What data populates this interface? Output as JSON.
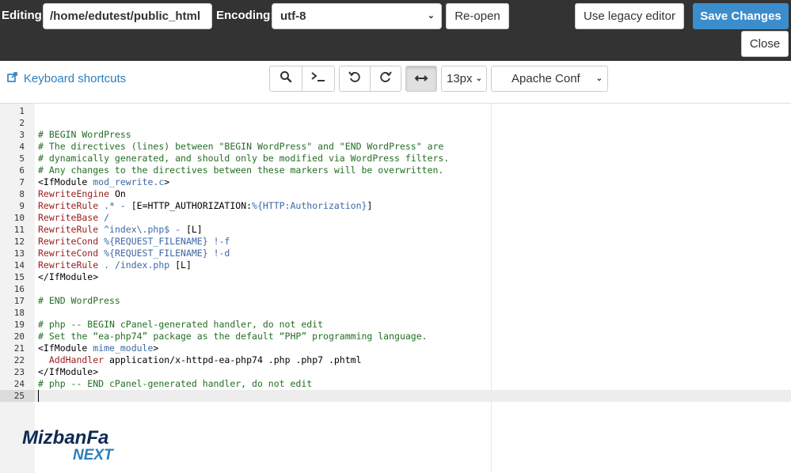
{
  "header": {
    "editing_label": "Editing:",
    "file_path": "/home/edutest/public_html",
    "encoding_label": "Encoding:",
    "encoding_value": "utf-8",
    "reopen_label": "Re-open",
    "legacy_label": "Use legacy editor",
    "save_label": "Save Changes",
    "close_label": "Close"
  },
  "toolbar": {
    "keyboard_shortcuts": "Keyboard shortcuts",
    "font_size": "13px",
    "mode": "Apache Conf"
  },
  "icons": [
    "external-link-icon",
    "search-icon",
    "terminal-icon",
    "undo-icon",
    "redo-icon",
    "wrap-icon",
    "chevron-down-icon"
  ],
  "colors": {
    "topbar": "#333333",
    "primary": "#3c8dcb",
    "link": "#2a7fbd",
    "comment": "#236e24",
    "keyword": "#9b1b1b",
    "variable": "#3e68a8"
  },
  "editor": {
    "lines": [
      {
        "n": "1",
        "tokens": []
      },
      {
        "n": "2",
        "tokens": []
      },
      {
        "n": "3",
        "tokens": [
          {
            "c": "comment",
            "t": "# BEGIN WordPress"
          }
        ]
      },
      {
        "n": "4",
        "tokens": [
          {
            "c": "comment",
            "t": "# The directives (lines) between \"BEGIN WordPress\" and \"END WordPress\" are"
          }
        ]
      },
      {
        "n": "5",
        "tokens": [
          {
            "c": "comment",
            "t": "# dynamically generated, and should only be modified via WordPress filters."
          }
        ]
      },
      {
        "n": "6",
        "tokens": [
          {
            "c": "comment",
            "t": "# Any changes to the directives between these markers will be overwritten."
          }
        ]
      },
      {
        "n": "7",
        "tokens": [
          {
            "c": "plain",
            "t": "<IfModule "
          },
          {
            "c": "var",
            "t": "mod_rewrite.c"
          },
          {
            "c": "plain",
            "t": ">"
          }
        ]
      },
      {
        "n": "8",
        "tokens": [
          {
            "c": "kw",
            "t": "RewriteEngine"
          },
          {
            "c": "plain",
            "t": " On"
          }
        ]
      },
      {
        "n": "9",
        "tokens": [
          {
            "c": "kw",
            "t": "RewriteRule"
          },
          {
            "c": "var",
            "t": " .* - "
          },
          {
            "c": "plain",
            "t": "[E=HTTP_AUTHORIZATION:"
          },
          {
            "c": "var",
            "t": "%{HTTP:Authorization}"
          },
          {
            "c": "plain",
            "t": "]"
          }
        ]
      },
      {
        "n": "10",
        "tokens": [
          {
            "c": "kw",
            "t": "RewriteBase"
          },
          {
            "c": "var",
            "t": " /"
          }
        ]
      },
      {
        "n": "11",
        "tokens": [
          {
            "c": "kw",
            "t": "RewriteRule"
          },
          {
            "c": "var",
            "t": " ^index\\.php$ - "
          },
          {
            "c": "plain",
            "t": "[L]"
          }
        ]
      },
      {
        "n": "12",
        "tokens": [
          {
            "c": "kw",
            "t": "RewriteCond"
          },
          {
            "c": "var",
            "t": " %{REQUEST_FILENAME} !-f"
          }
        ]
      },
      {
        "n": "13",
        "tokens": [
          {
            "c": "kw",
            "t": "RewriteCond"
          },
          {
            "c": "var",
            "t": " %{REQUEST_FILENAME} !-d"
          }
        ]
      },
      {
        "n": "14",
        "tokens": [
          {
            "c": "kw",
            "t": "RewriteRule"
          },
          {
            "c": "var",
            "t": " . /index.php "
          },
          {
            "c": "plain",
            "t": "[L]"
          }
        ]
      },
      {
        "n": "15",
        "tokens": [
          {
            "c": "plain",
            "t": "</IfModule>"
          }
        ]
      },
      {
        "n": "16",
        "tokens": []
      },
      {
        "n": "17",
        "tokens": [
          {
            "c": "comment",
            "t": "# END WordPress"
          }
        ]
      },
      {
        "n": "18",
        "tokens": []
      },
      {
        "n": "19",
        "tokens": [
          {
            "c": "comment",
            "t": "# php -- BEGIN cPanel-generated handler, do not edit"
          }
        ]
      },
      {
        "n": "20",
        "tokens": [
          {
            "c": "comment",
            "t": "# Set the “ea-php74” package as the default “PHP” programming language."
          }
        ]
      },
      {
        "n": "21",
        "tokens": [
          {
            "c": "plain",
            "t": "<IfModule "
          },
          {
            "c": "var",
            "t": "mime_module"
          },
          {
            "c": "plain",
            "t": ">"
          }
        ]
      },
      {
        "n": "22",
        "tokens": [
          {
            "c": "kw",
            "t": "  AddHandler"
          },
          {
            "c": "plain",
            "t": " application/x-httpd-ea-php74 .php .php7 .phtml"
          }
        ]
      },
      {
        "n": "23",
        "tokens": [
          {
            "c": "plain",
            "t": "</IfModule>"
          }
        ]
      },
      {
        "n": "24",
        "tokens": [
          {
            "c": "comment",
            "t": "# php -- END cPanel-generated handler, do not edit"
          }
        ]
      },
      {
        "n": "25",
        "tokens": []
      }
    ],
    "active_line": "25"
  },
  "logo": {
    "line1": "MizbanFa",
    "line2": "NEXT"
  }
}
